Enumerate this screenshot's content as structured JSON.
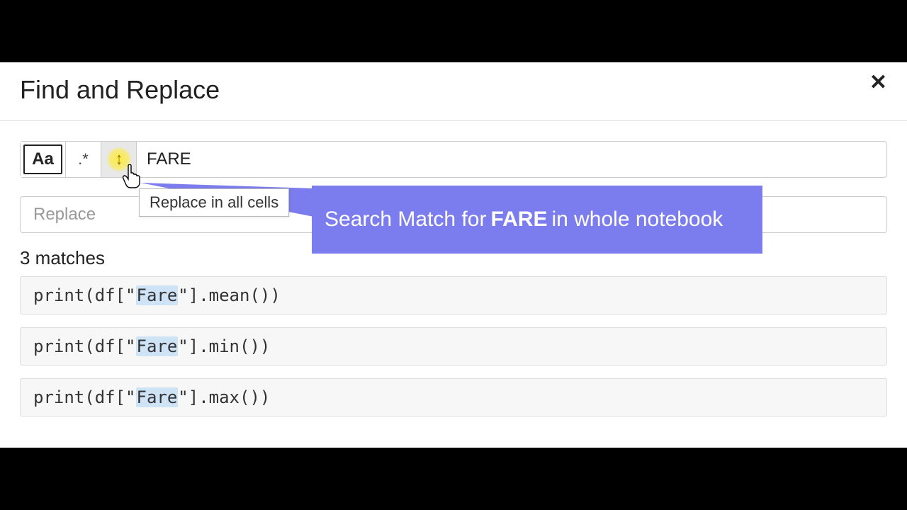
{
  "dialog": {
    "title": "Find and Replace",
    "close_glyph": "✕"
  },
  "search": {
    "case_label": "Aa",
    "regex_label": ".*",
    "cells_glyph": "↕",
    "value": "FARE"
  },
  "replace": {
    "placeholder": "Replace"
  },
  "tooltip": {
    "text": "Replace in all cells"
  },
  "callout": {
    "prefix": "Search Match for",
    "term": "FARE",
    "suffix": "in whole notebook"
  },
  "results": {
    "count_label": "3 matches",
    "items": [
      {
        "pre": "print(df[\"",
        "match": "Fare",
        "post": "\"].mean())"
      },
      {
        "pre": "print(df[\"",
        "match": "Fare",
        "post": "\"].min())"
      },
      {
        "pre": "print(df[\"",
        "match": "Fare",
        "post": "\"].max())"
      }
    ]
  }
}
